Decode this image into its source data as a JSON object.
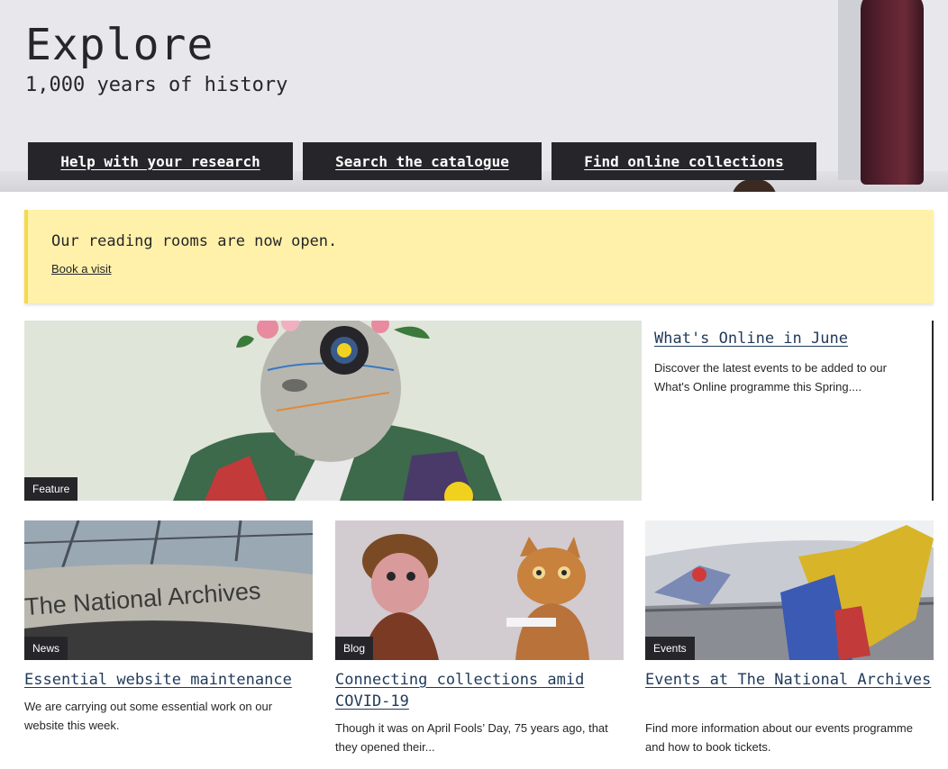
{
  "hero": {
    "title": "Explore",
    "subtitle": "1,000 years of history",
    "buttons": [
      {
        "label": "Help with your research"
      },
      {
        "label": "Search the catalogue"
      },
      {
        "label": "Find online collections"
      }
    ]
  },
  "notice": {
    "text": "Our reading rooms are now open.",
    "link": "Book a visit"
  },
  "feature": {
    "tag": "Feature",
    "title": "What's Online in June",
    "description": "Discover the latest events to be added to our What's Online programme this Spring...."
  },
  "cards": [
    {
      "tag": "News",
      "image_text": "The National Archives",
      "title": "Essential website maintenance",
      "description": "We are carrying out some essential work on our website this week."
    },
    {
      "tag": "Blog",
      "title": "Connecting collections amid COVID-19",
      "description": "Though it was on April Fools’ Day, 75 years ago, that they opened their..."
    },
    {
      "tag": "Events",
      "title": "Events at The National Archives",
      "description": "Find more information about our events programme and how to book tickets."
    }
  ],
  "colors": {
    "dark": "#26262a",
    "notice_bg": "#fff1a9",
    "link": "#1f3a5a"
  }
}
